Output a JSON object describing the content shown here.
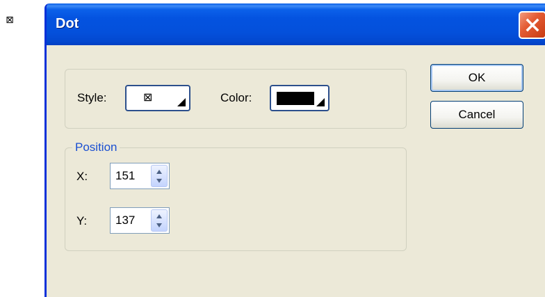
{
  "canvas": {
    "dot_glyph": "⊠"
  },
  "window": {
    "title": "Dot",
    "close_icon": "close-icon"
  },
  "appearance": {
    "style_label": "Style:",
    "style_value": "⊠",
    "color_label": "Color:",
    "color_value": "#000000"
  },
  "position": {
    "legend": "Position",
    "x_label": "X:",
    "x_value": "151",
    "y_label": "Y:",
    "y_value": "137"
  },
  "buttons": {
    "ok": "OK",
    "cancel": "Cancel"
  },
  "colors": {
    "titlebar": "#0453e0",
    "dialog_bg": "#ece9d8",
    "group_legend": "#1a4fd1",
    "close_button": "#e45c34"
  }
}
